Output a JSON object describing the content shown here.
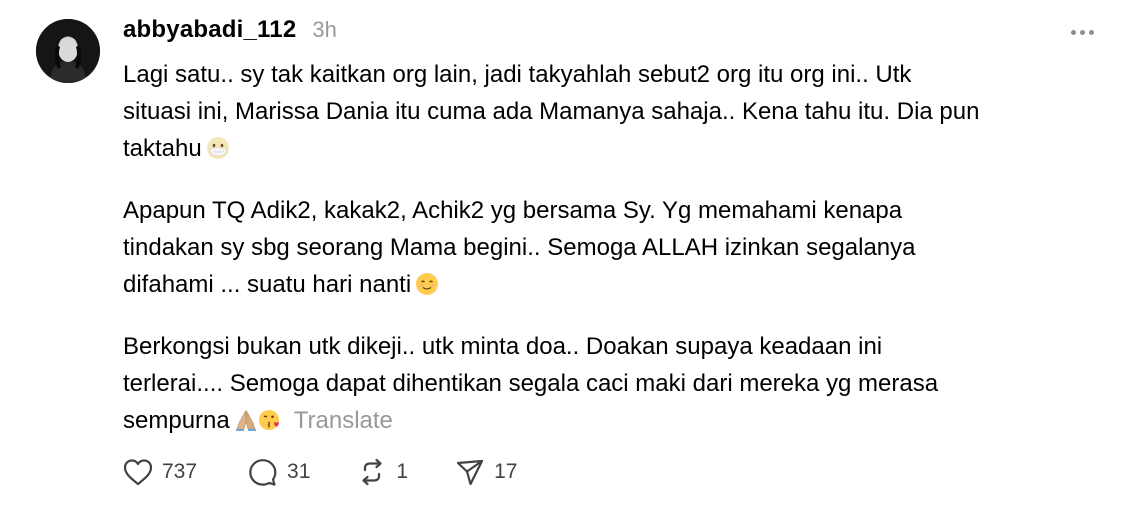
{
  "post": {
    "author": "abbyabadi_112",
    "time": "3h",
    "paragraphs": [
      {
        "lines": [
          "Lagi satu.. sy tak kaitkan org lain, jadi takyahlah sebut2 org itu org ini.. Utk",
          "situasi ini, Marissa Dania itu cuma ada Mamanya sahaja.. Kena tahu itu. Dia pun",
          "taktahu"
        ],
        "trailing_emoji": "face-with-medical-mask-emoji"
      },
      {
        "lines": [
          "Apapun TQ Adik2, kakak2, Achik2 yg bersama Sy. Yg memahami kenapa",
          "tindakan sy sbg seorang Mama begini.. Semoga ALLAH izinkan segalanya",
          "difahami ... suatu hari nanti"
        ],
        "trailing_emoji": "smiling-face-emoji"
      },
      {
        "lines": [
          "Berkongsi bukan utk dikeji.. utk minta doa.. Doakan supaya keadaan ini",
          "terlerai.... Semoga dapat dihentikan segala caci maki dari mereka yg merasa",
          "sempurna"
        ],
        "trailing_emoji": "folded-hands-emoji, face-blowing-a-kiss-emoji"
      }
    ],
    "translate_label": "Translate"
  },
  "actions": {
    "likes": "737",
    "replies": "31",
    "reposts": "1",
    "shares": "17"
  },
  "icons": {
    "more": "more-horizontal-icon",
    "like": "heart-icon",
    "reply": "comment-bubble-icon",
    "repost": "repost-icon",
    "share": "send-icon"
  },
  "colors": {
    "text": "#000000",
    "muted": "#999999",
    "action_text": "#424242"
  }
}
